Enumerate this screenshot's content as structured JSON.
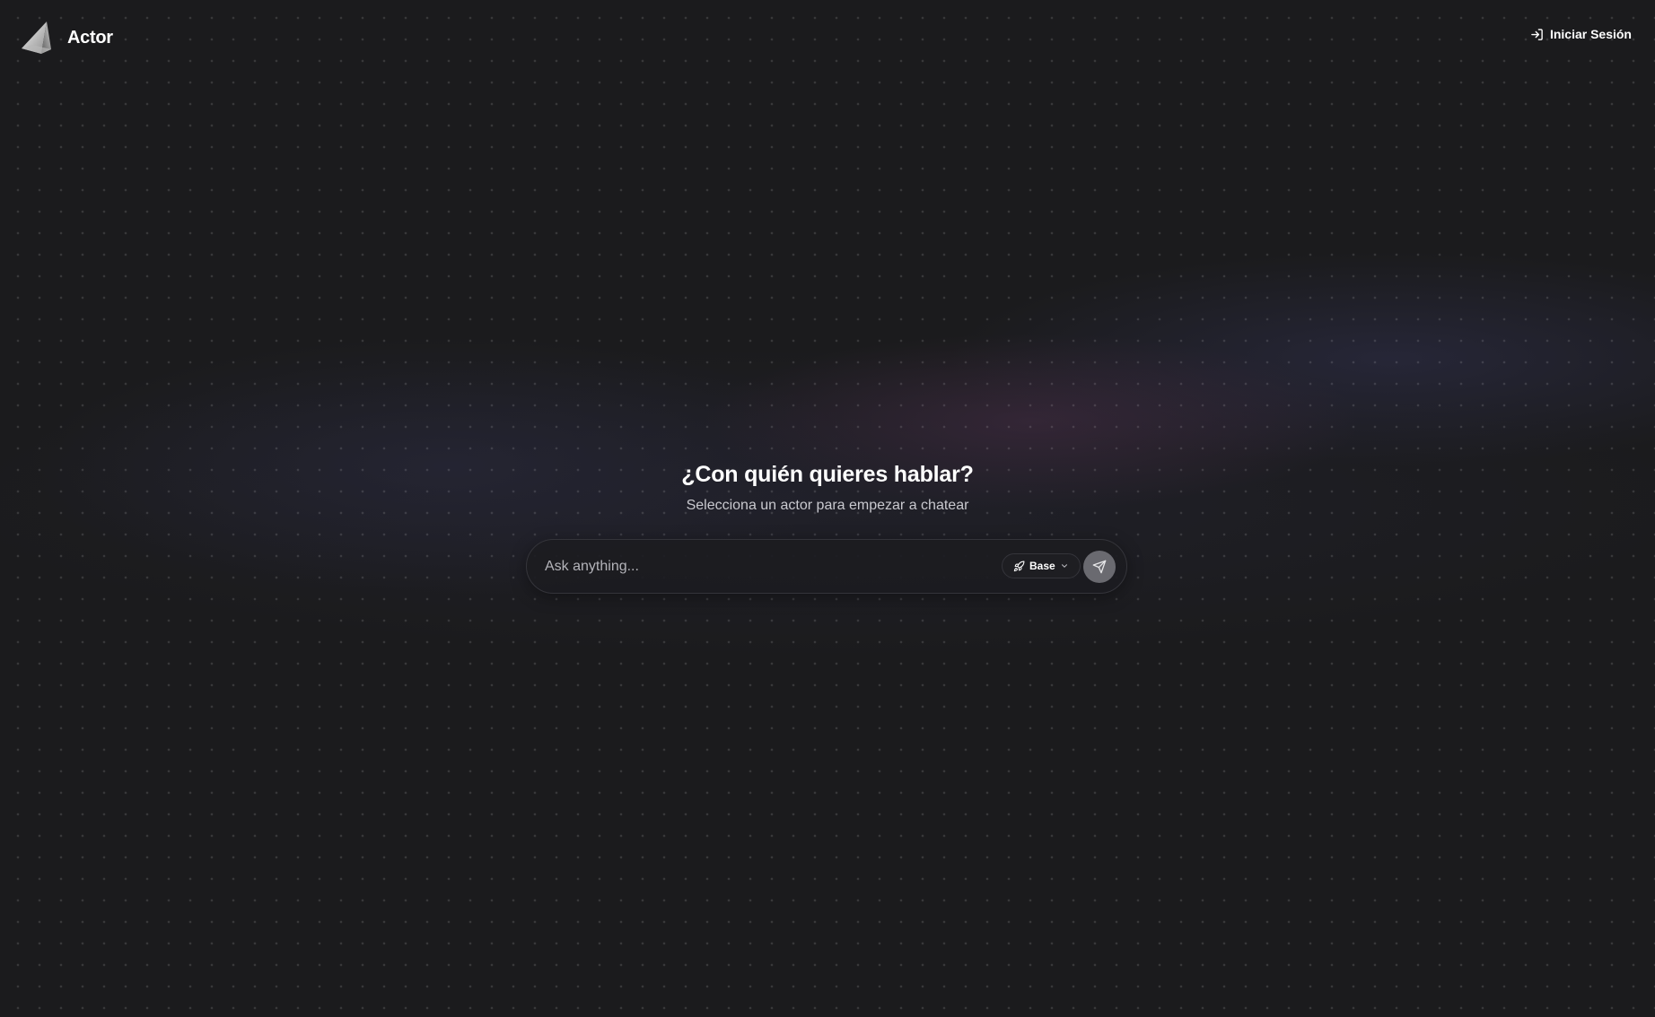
{
  "header": {
    "brand_name": "Actor",
    "logo_icon": "pyramid-logo",
    "login_label": "Iniciar Sesión",
    "login_icon": "sign-in-icon"
  },
  "hero": {
    "title": "¿Con quién quieres hablar?",
    "subtitle": "Selecciona un actor para empezar a chatear"
  },
  "composer": {
    "input_placeholder": "Ask anything...",
    "input_value": "",
    "model_icon": "rocket-icon",
    "model_label": "Base",
    "send_icon": "send-icon"
  },
  "colors": {
    "background": "#1b1b1d",
    "composer_border": "#34343a",
    "send_button": "#6a6a70",
    "text_primary": "#ffffff",
    "text_secondary": "#c9c9cf"
  }
}
